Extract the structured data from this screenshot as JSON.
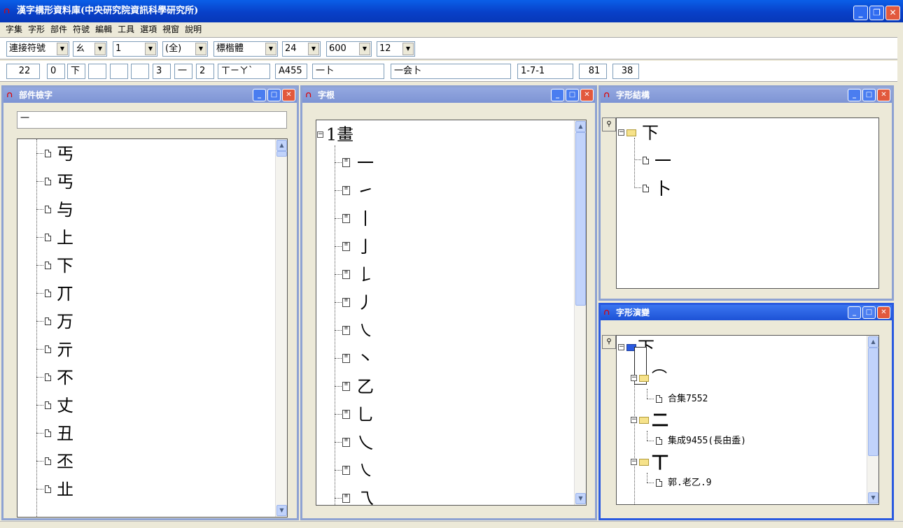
{
  "app": {
    "title": "漢字構形資料庫(中央研究院資訊科學研究所)",
    "icon": "app-logo-icon"
  },
  "window_buttons": {
    "minimize": "_",
    "restore": "❐",
    "close": "✕"
  },
  "menu": [
    "字集",
    "字形",
    "部件",
    "符號",
    "編輯",
    "工具",
    "選項",
    "視窗",
    "說明"
  ],
  "toolbar": {
    "connector": "連接符號",
    "symbol": "ㄠ",
    "level": "1",
    "scope": "(全)",
    "font": "標楷體",
    "size": "24",
    "width": "600",
    "small_size": "12"
  },
  "info": {
    "f1": "22",
    "f2": "0",
    "f3": "下",
    "f4": "",
    "f5": "",
    "f6": "",
    "f7": "3",
    "f8": "一",
    "f9": "2",
    "f10": "ㄒㄧㄚˋ",
    "f11": "A455",
    "f12": "一卜",
    "f13": "一会卜",
    "f14": "1-7-1",
    "f15": "81",
    "f16": "38"
  },
  "component_search": {
    "title": "部件檢字",
    "query": "一",
    "items": [
      "丐",
      "丐",
      "与",
      "上",
      "下",
      "丌",
      "万",
      "亓",
      "不",
      "丈",
      "丑",
      "丕",
      "㐀"
    ]
  },
  "radicals": {
    "title": "字根",
    "group": "1畫",
    "items": [
      "一",
      "㇀",
      "丨",
      "亅",
      "𠄌",
      "丿",
      "㇏",
      "丶",
      "乙",
      "乚",
      "乀",
      "㇏",
      "乁"
    ]
  },
  "structure": {
    "title": "字形結構",
    "root": "下",
    "children": [
      "一",
      "卜"
    ]
  },
  "evolution": {
    "title": "字形演變",
    "root": "下",
    "stages": [
      {
        "glyph": "⌒",
        "source": "合集7552"
      },
      {
        "glyph": "二",
        "source": "集成9455(長甶盉)"
      },
      {
        "glyph": "丅",
        "source": "郭.老乙.9"
      }
    ]
  },
  "colors": {
    "titlebar": "#0a5fe8",
    "active_border": "#2a5ae0",
    "inactive_title": "#8ea2d2"
  }
}
